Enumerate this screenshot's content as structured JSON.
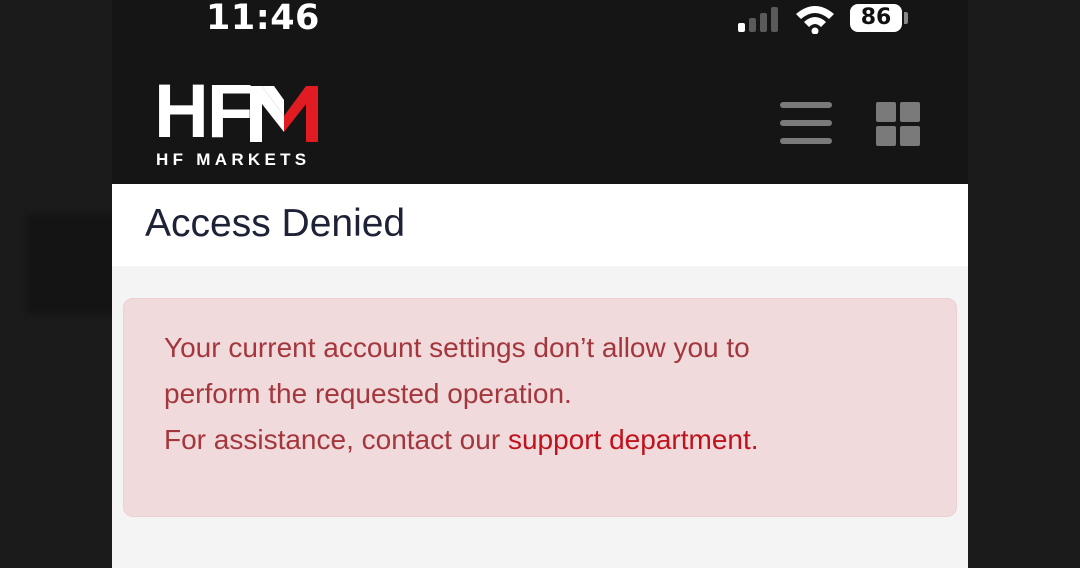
{
  "status_bar": {
    "time": "11:46",
    "battery": "86",
    "signal_bars_active": 1,
    "signal_bars_total": 4
  },
  "header": {
    "logo_text": "HFM",
    "logo_subtitle": "HF MARKETS",
    "logo_accent_color": "#e11b22",
    "menu_icon": "hamburger-menu-icon",
    "apps_icon": "grid-apps-icon"
  },
  "page": {
    "title": "Access Denied"
  },
  "alert": {
    "line1": "Your current account settings don’t allow you to",
    "line2": "perform the requested operation.",
    "line3_prefix": "For assistance, contact our ",
    "link_text": "support department",
    "line3_suffix": ".",
    "text_color": "#a4373d",
    "link_color": "#c0121c",
    "background_color": "#f0dadc"
  }
}
